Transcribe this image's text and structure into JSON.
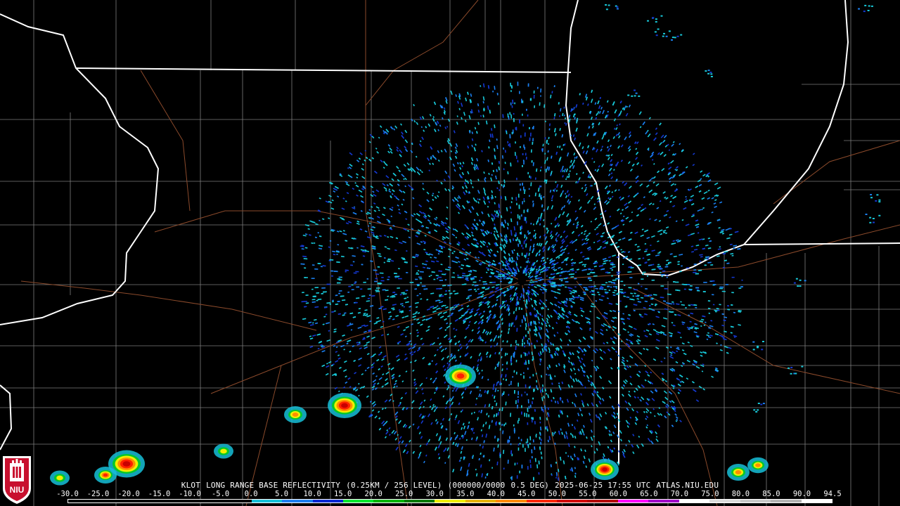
{
  "radar": {
    "station": "KLOT",
    "product": "LONG RANGE BASE REFLECTIVITY",
    "resolution": "(0.25KM / 256 LEVEL)",
    "volume": "(000000/0000",
    "elevation": "0.5 DEG)",
    "timestamp": "2025-06-25 17:55 UTC",
    "site": "ATLAS.NIU.EDU"
  },
  "scale": {
    "labels": [
      "-30.0",
      "-25.0",
      "-20.0",
      "-15.0",
      "-10.0",
      "-5.0",
      "0.0",
      "5.0",
      "10.0",
      "15.0",
      "20.0",
      "25.0",
      "30.0",
      "35.0",
      "40.0",
      "45.0",
      "50.0",
      "55.0",
      "60.0",
      "65.0",
      "70.0",
      "75.0",
      "80.0",
      "85.0",
      "90.0",
      "94.5"
    ],
    "colors": [
      "#000000",
      "#000000",
      "#000000",
      "#000000",
      "#000000",
      "#000000",
      "#16c0d8",
      "#1e7ff0",
      "#0a28d2",
      "#06e630",
      "#04b40c",
      "#0a7a0a",
      "#f0f000",
      "#e6b400",
      "#ff8c00",
      "#ff2800",
      "#d20000",
      "#b40000",
      "#ff00ff",
      "#a000c8",
      "#ffffff",
      "#dcdcdc",
      "#c8c8c8",
      "#b4b4b4",
      "#ffffff"
    ]
  },
  "logo": {
    "text": "NIU",
    "colors": {
      "shield": "#c8102e",
      "text": "#ffffff",
      "background": "#ffffff"
    }
  },
  "map_colors": {
    "state_border": "#ffffff",
    "county_border": "#8a8a8a",
    "road": "#8b4a2b",
    "echo_light": "#18c8d8",
    "echo_mid": "#1a7ff0",
    "echo_dark": "#1438d0"
  }
}
